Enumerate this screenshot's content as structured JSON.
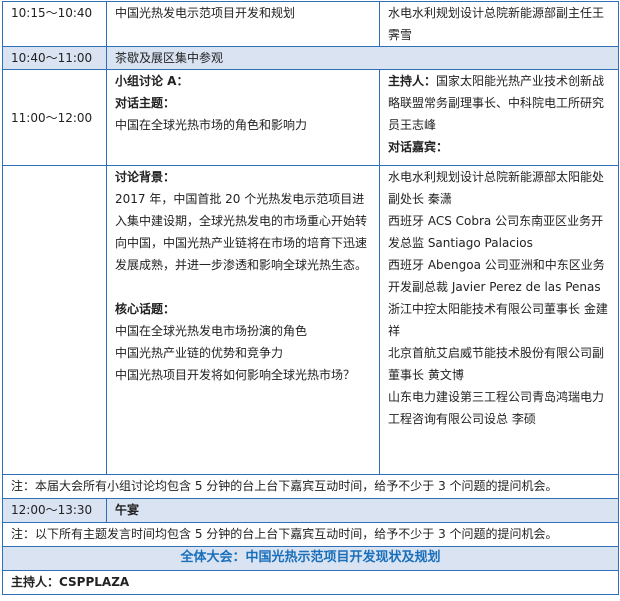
{
  "rows": {
    "r1": {
      "time": "10:15～10:40",
      "topic": "中国光热发电示范项目开发和规划",
      "speaker": "水电水利规划设计总院新能源部副主任王霁雪"
    },
    "r2": {
      "time": "10:40～11:00",
      "topic": "茶歇及展区集中参观"
    },
    "r3": {
      "time": "11:00～12:00",
      "group_label": "小组讨论 A：",
      "theme_label": "对话主题：",
      "theme": "中国在全球光热市场的角色和影响力",
      "host_label": "主持人：",
      "host": "国家太阳能光热产业技术创新战略联盟常务副理事长、中科院电工所研究员王志峰",
      "guests_label": "对话嘉宾："
    },
    "r4": {
      "background_label": "讨论背景：",
      "background": "2017 年，中国首批 20 个光热发电示范项目进入集中建设期，全球光热发电的市场重心开始转向中国，中国光热产业链将在市场的培育下迅速发展成熟，并进一步渗透和影响全球光热生态。",
      "core_label": "核心话题：",
      "core_topics": [
        "中国在全球光热发电市场扮演的角色",
        "中国光热产业链的优势和竞争力",
        "中国光热项目开发将如何影响全球光热市场？"
      ],
      "guests": [
        "水电水利规划设计总院新能源部太阳能处副处长 秦潇",
        "西班牙 ACS Cobra 公司东南亚区业务开发总监 Santiago Palacios",
        "西班牙 Abengoa 公司亚洲和中东区业务开发副总裁 Javier Perez de las Penas",
        "浙江中控太阳能技术有限公司董事长 金建祥",
        "北京首航艾启威节能技术股份有限公司副董事长 黄文博",
        "山东电力建设第三工程公司青岛鸿瑞电力工程咨询有限公司设总 李硕"
      ]
    },
    "note1": "注：本届大会所有小组讨论均包含 5 分钟的台上台下嘉宾互动时间，给予不少于 3 个问题的提问机会。",
    "r5": {
      "time": "12:00～13:30",
      "topic": "午宴"
    },
    "note2": "注：以下所有主题发言时间均包含 5 分钟的台上台下嘉宾互动时间，给予不少于 3 个问题的提问机会。",
    "plenary_title": "全体大会：中国光热示范项目开发现状及规划",
    "host_line": "主持人：CSPPLAZA"
  }
}
